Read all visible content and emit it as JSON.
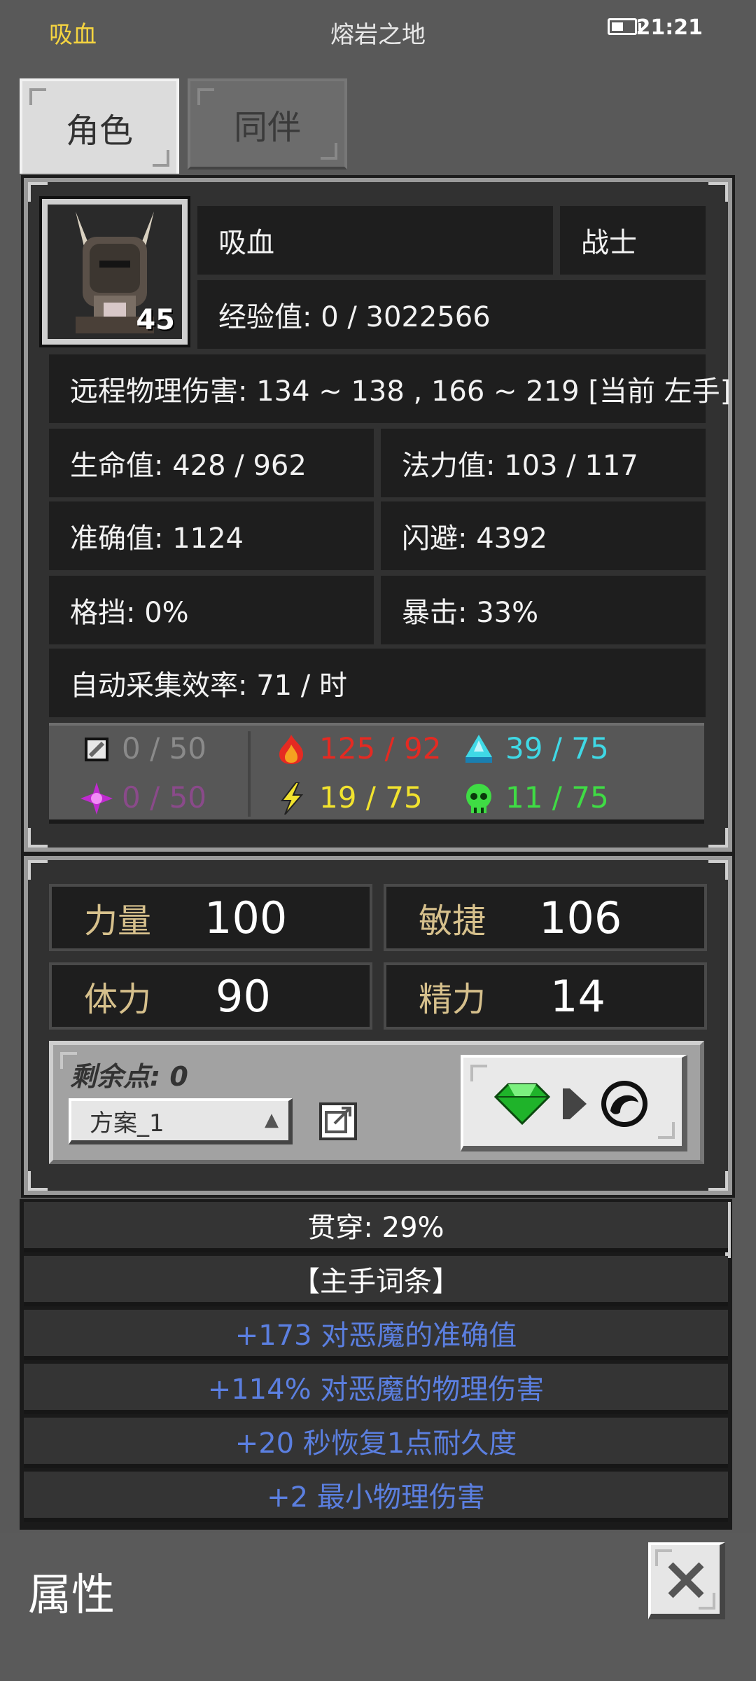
{
  "status_bar": {
    "left": "吸血",
    "center": "熔岩之地",
    "time": "21:21"
  },
  "tabs": [
    {
      "label": "角色"
    },
    {
      "label": "同伴"
    }
  ],
  "character": {
    "level": "45",
    "name": "吸血",
    "class": "战士",
    "exp": "经验值: 0 / 3022566",
    "damage": "远程物理伤害: 134 ~ 138 , 166 ~ 219 [当前 左手]",
    "hp": "生命值: 428 / 962",
    "mp": "法力值: 103 / 117",
    "accuracy": "准确值: 1124",
    "dodge": "闪避: 4392",
    "block": "格挡: 0%",
    "crit": "暴击: 33%",
    "gather": "自动采集效率: 71 / 时"
  },
  "resistances": [
    {
      "icon": "physical-resist-icon",
      "value": "0 / 50",
      "color": "#8a8a8a"
    },
    {
      "icon": "fire-icon",
      "value": "125 / 92",
      "color": "#e52a22"
    },
    {
      "icon": "water-icon",
      "value": "39 / 75",
      "color": "#3fd9e6"
    },
    {
      "icon": "arcane-icon",
      "value": "0 / 50",
      "color": "#8a4a8a"
    },
    {
      "icon": "lightning-icon",
      "value": "19 / 75",
      "color": "#f2e32e"
    },
    {
      "icon": "poison-skull-icon",
      "value": "11 / 75",
      "color": "#3fdc44"
    }
  ],
  "attributes": [
    {
      "label": "力量",
      "value": "100"
    },
    {
      "label": "敏捷",
      "value": "106"
    },
    {
      "label": "体力",
      "value": "90"
    },
    {
      "label": "精力",
      "value": "14"
    }
  ],
  "points": {
    "remaining": "剩余点: 0",
    "scheme": "方案_1"
  },
  "item_list": [
    {
      "text": "贯穿: 29%",
      "color": "#ffffff"
    },
    {
      "text": "【主手词条】",
      "color": "#ffffff"
    },
    {
      "text": "+173 对恶魔的准确值",
      "color": "#5b7fe0"
    },
    {
      "text": "+114% 对恶魔的物理伤害",
      "color": "#5b7fe0"
    },
    {
      "text": "+20 秒恢复1点耐久度",
      "color": "#5b7fe0"
    },
    {
      "text": "+2 最小物理伤害",
      "color": "#5b7fe0"
    }
  ],
  "footer": {
    "title": "属性"
  }
}
